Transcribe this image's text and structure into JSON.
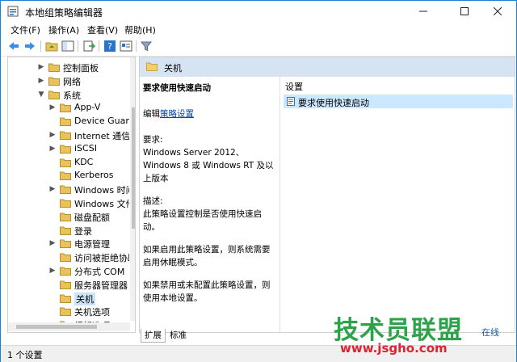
{
  "window": {
    "title": "本地组策略编辑器"
  },
  "menu": [
    "文件(F)",
    "操作(A)",
    "查看(V)",
    "帮助(H)"
  ],
  "tree": {
    "items": [
      {
        "label": "控制面板",
        "level": 1,
        "expander": "▶"
      },
      {
        "label": "网络",
        "level": 1,
        "expander": "▶"
      },
      {
        "label": "系统",
        "level": 1,
        "expander": "▼"
      },
      {
        "label": "App-V",
        "level": 2,
        "expander": "▶"
      },
      {
        "label": "Device Guard",
        "level": 2,
        "expander": ""
      },
      {
        "label": "Internet 通信管理",
        "level": 2,
        "expander": "▶"
      },
      {
        "label": "iSCSI",
        "level": 2,
        "expander": "▶"
      },
      {
        "label": "KDC",
        "level": 2,
        "expander": ""
      },
      {
        "label": "Kerberos",
        "level": 2,
        "expander": ""
      },
      {
        "label": "Windows 时间服务",
        "level": 2,
        "expander": "▶"
      },
      {
        "label": "Windows 文件保护",
        "level": 2,
        "expander": ""
      },
      {
        "label": "磁盘配额",
        "level": 2,
        "expander": ""
      },
      {
        "label": "登录",
        "level": 2,
        "expander": ""
      },
      {
        "label": "电源管理",
        "level": 2,
        "expander": "▶"
      },
      {
        "label": "访问被拒绝协助",
        "level": 2,
        "expander": ""
      },
      {
        "label": "分布式 COM",
        "level": 2,
        "expander": "▶"
      },
      {
        "label": "服务器管理器",
        "level": 2,
        "expander": ""
      },
      {
        "label": "关机",
        "level": 2,
        "expander": "",
        "selected": true
      },
      {
        "label": "关机选项",
        "level": 2,
        "expander": ""
      },
      {
        "label": "缓解选项",
        "level": 2,
        "expander": ""
      }
    ]
  },
  "right": {
    "header": "关机",
    "desc": {
      "title": "要求使用快速启动",
      "edit_prefix": "编辑",
      "edit_link": "策略设置",
      "req_label": "要求:",
      "req_text": "Windows Server 2012、Windows 8 或 Windows RT 及以上版本",
      "desc_label": "描述:",
      "desc_text": "此策略设置控制是否使用快速启动。",
      "p2": "如果启用此策略设置，则系统需要启用休眠模式。",
      "p3": "如果禁用或未配置此策略设置，则使用本地设置。"
    },
    "list_header": "设置",
    "list_items": [
      "要求使用快速启动"
    ]
  },
  "tabs": [
    "扩展",
    "标准"
  ],
  "status": "1 个设置",
  "watermark": {
    "big": "技术员联盟",
    "small": "在线",
    "url": "www.jsgho.com"
  },
  "colors": {
    "accent": "#1f7fd6",
    "header_bg": "#d5e3f2",
    "selection": "#cce8ff",
    "folder": "#e8c25a"
  }
}
